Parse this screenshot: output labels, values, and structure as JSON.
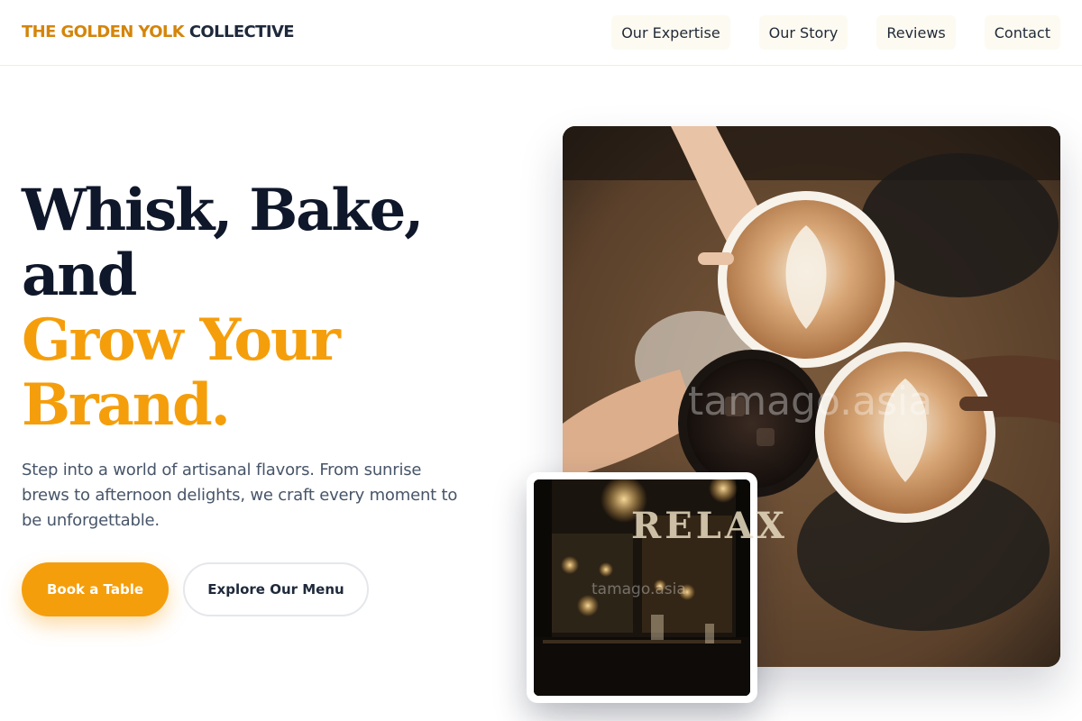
{
  "header": {
    "logo_accent": "THE GOLDEN YOLK",
    "logo_rest": "COLLECTIVE",
    "nav": [
      "Our Expertise",
      "Our Story",
      "Reviews",
      "Contact"
    ]
  },
  "hero": {
    "headline_line1": "Whisk, Bake,",
    "headline_line2": "and",
    "headline_line3": "Grow Your",
    "headline_line4": "Brand.",
    "subtitle": "Step into a world of artisanal flavors. From sunrise brews to afternoon delights, we craft every moment to be unforgettable.",
    "primary_cta": "Book a Table",
    "secondary_cta": "Explore Our Menu"
  },
  "images": {
    "main_watermark": "tamago.asia",
    "inset_watermark": "tamago.asia",
    "inset_sign": "RELAX"
  },
  "colors": {
    "accent": "#f59e0b",
    "logo_accent": "#d4850a",
    "dark": "#0f172a",
    "muted": "#475569"
  }
}
